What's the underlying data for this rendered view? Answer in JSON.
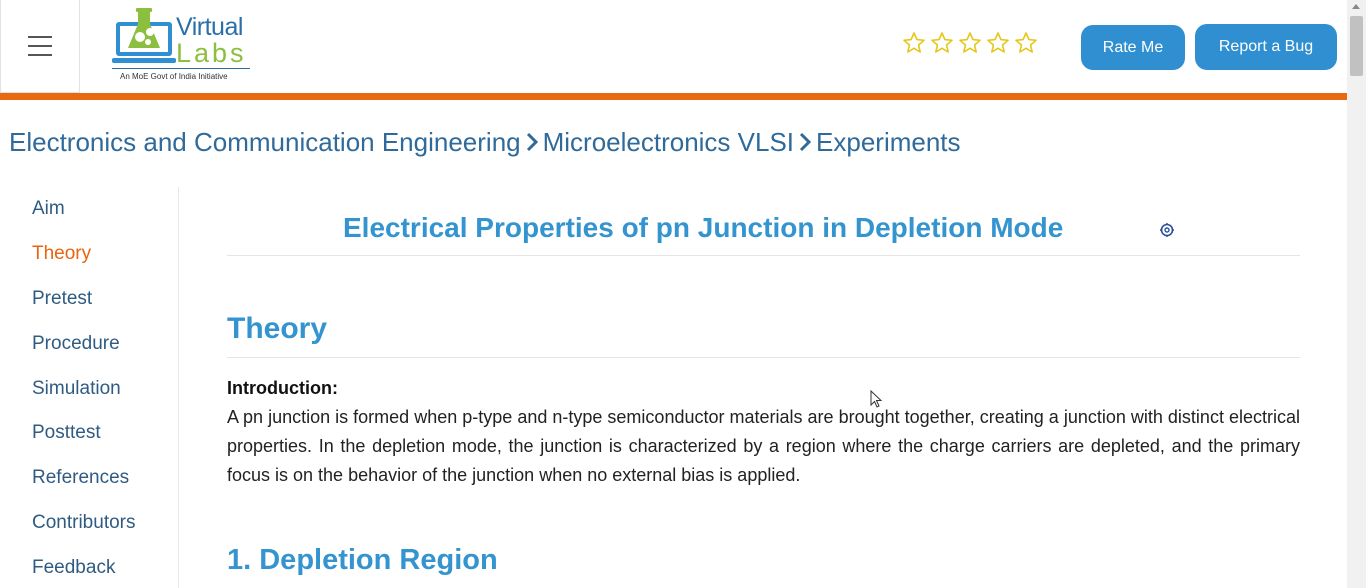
{
  "header": {
    "menu_label": "Menu",
    "logo": {
      "line1": "Virtual",
      "line2": "Labs",
      "tagline": "An MoE Govt of India Initiative"
    },
    "rating": {
      "stars_total": 5,
      "stars_filled": 0,
      "star_color": "#e6c619"
    },
    "rate_button": "Rate Me",
    "bug_button": "Report a Bug",
    "accent_bar_color": "#e86a10",
    "button_color": "#2f8fd0"
  },
  "breadcrumb": {
    "items": [
      "Electronics and Communication Engineering",
      "Microelectronics VLSI",
      "Experiments"
    ]
  },
  "sidebar": {
    "items": [
      {
        "label": "Aim"
      },
      {
        "label": "Theory"
      },
      {
        "label": "Pretest"
      },
      {
        "label": "Procedure"
      },
      {
        "label": "Simulation"
      },
      {
        "label": "Posttest"
      },
      {
        "label": "References"
      },
      {
        "label": "Contributors"
      },
      {
        "label": "Feedback"
      }
    ],
    "active_label": "Theory",
    "active_color": "#e8650f"
  },
  "main": {
    "experiment_title": "Electrical Properties of pn Junction in Depletion Mode",
    "section_heading": "Theory",
    "intro_label": "Introduction:",
    "intro_text": "A pn junction is formed when p-type and n-type semiconductor materials are brought together, creating a junction with distinct electrical properties. In the depletion mode, the junction is characterized by a region where the charge carriers are depleted, and the primary focus is on the behavior of the junction when no external bias is applied.",
    "subheading": "1. Depletion Region",
    "heading_color": "#3494cf"
  }
}
